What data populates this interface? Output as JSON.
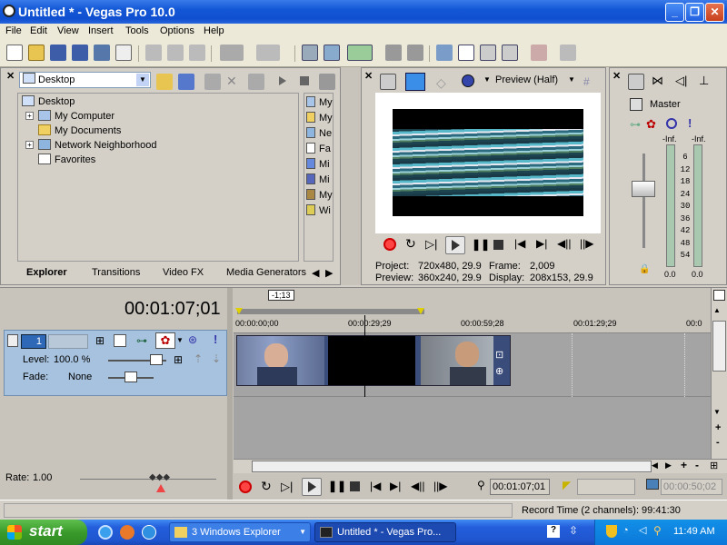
{
  "window": {
    "title": "Untitled * - Vegas Pro 10.0"
  },
  "menu": [
    "File",
    "Edit",
    "View",
    "Insert",
    "Tools",
    "Options",
    "Help"
  ],
  "explorer": {
    "location": "Desktop",
    "tree": [
      {
        "label": "Desktop",
        "expander": ""
      },
      {
        "label": "My Computer",
        "expander": "+"
      },
      {
        "label": "My Documents",
        "expander": ""
      },
      {
        "label": "Network Neighborhood",
        "expander": "+"
      },
      {
        "label": "Favorites",
        "expander": ""
      }
    ],
    "files": [
      "My",
      "My",
      "Ne",
      "Fa",
      "Mi",
      "Mi",
      "My",
      "Wi"
    ],
    "tabs": [
      "Explorer",
      "Transitions",
      "Video FX",
      "Media Generators"
    ]
  },
  "preview": {
    "mode": "Preview (Half)",
    "project_label": "Project:",
    "project_value": "720x480, 29.9",
    "preview_label": "Preview:",
    "preview_value": "360x240, 29.9",
    "frame_label": "Frame:",
    "frame_value": "2,009",
    "display_label": "Display:",
    "display_value": "208x153, 29.9"
  },
  "mixer": {
    "master_label": "Master",
    "inf_left": "-Inf.",
    "inf_right": "-Inf.",
    "scale": [
      "6",
      "12",
      "18",
      "24",
      "30",
      "36",
      "42",
      "48",
      "54"
    ],
    "val_left": "0.0",
    "val_right": "0.0"
  },
  "timeline": {
    "timecode": "00:01:07;01",
    "region_marker": "-1;13",
    "ruler": [
      "00:00:00;00",
      "00:00:29;29",
      "00:00:59;28",
      "00:01:29;29",
      "00:0"
    ],
    "track": {
      "number": "1",
      "level_label": "Level:",
      "level_value": "100.0 %",
      "fade_label": "Fade:",
      "fade_value": "None"
    },
    "rate_label": "Rate:",
    "rate_value": "1.00",
    "transport_time": "00:01:07;01",
    "end_time": "00:00:50;02",
    "status": "Record Time (2 channels): 99:41:30"
  },
  "taskbar": {
    "start": "start",
    "tasks": [
      "3 Windows Explorer",
      "Untitled * - Vegas Pro..."
    ],
    "clock": "11:49 AM"
  }
}
